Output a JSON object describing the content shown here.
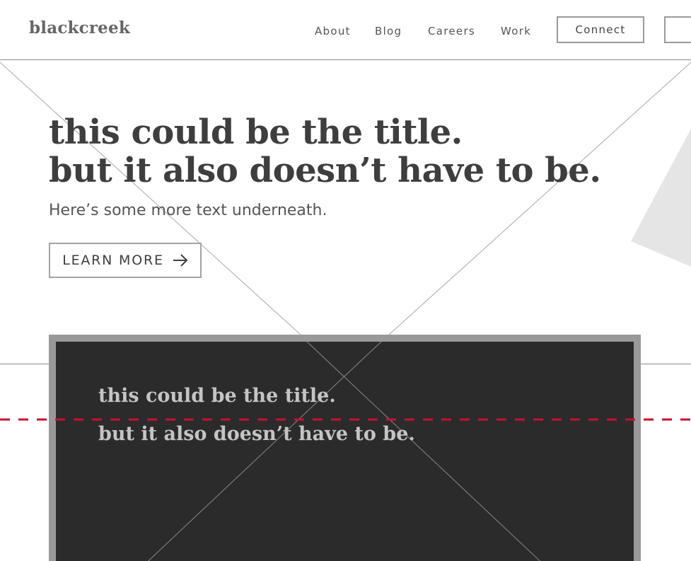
{
  "brand": {
    "logo": "blackcreek"
  },
  "nav": {
    "links": [
      "About",
      "Blog",
      "Careers",
      "Work"
    ],
    "connect_label": "Connect"
  },
  "hero": {
    "title_line1": "this could be the title.",
    "title_line2": "but it also doesn’t have to be.",
    "subtitle": "Here’s some more text underneath.",
    "cta_label": "LEARN MORE",
    "cta_icon": "arrow-right-icon"
  },
  "card": {
    "title_line1": "this could be the title.",
    "title_line2": "but it also doesn’t have to be."
  },
  "colors": {
    "text": "#3e3e3e",
    "card_background": "#2b2b2b",
    "card_border": "#999999",
    "guide_line": "#c8102e",
    "decor_triangle": "#e5e5e5"
  }
}
